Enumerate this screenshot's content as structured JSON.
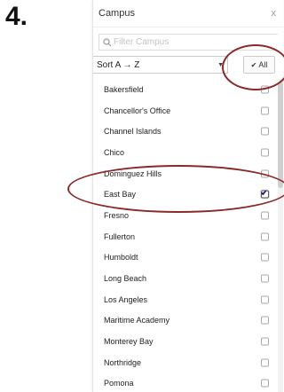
{
  "step": {
    "number": "4."
  },
  "panel": {
    "title": "Campus",
    "close_label": "x"
  },
  "search": {
    "placeholder": "Filter Campus",
    "value": ""
  },
  "sort": {
    "selected": "Sort A → Z"
  },
  "all_button": {
    "check": "✔",
    "label": "All"
  },
  "campuses": [
    {
      "label": "Bakersfield",
      "checked": false
    },
    {
      "label": "Chancellor's Office",
      "checked": false
    },
    {
      "label": "Channel Islands",
      "checked": false
    },
    {
      "label": "Chico",
      "checked": false
    },
    {
      "label": "Dominguez Hills",
      "checked": false
    },
    {
      "label": "East Bay",
      "checked": true
    },
    {
      "label": "Fresno",
      "checked": false
    },
    {
      "label": "Fullerton",
      "checked": false
    },
    {
      "label": "Humboldt",
      "checked": false
    },
    {
      "label": "Long Beach",
      "checked": false
    },
    {
      "label": "Los Angeles",
      "checked": false
    },
    {
      "label": "Maritime Academy",
      "checked": false
    },
    {
      "label": "Monterey Bay",
      "checked": false
    },
    {
      "label": "Northridge",
      "checked": false
    },
    {
      "label": "Pomona",
      "checked": false
    }
  ],
  "tick_glyph": "✔",
  "annotation_color": "#8c2a2a"
}
